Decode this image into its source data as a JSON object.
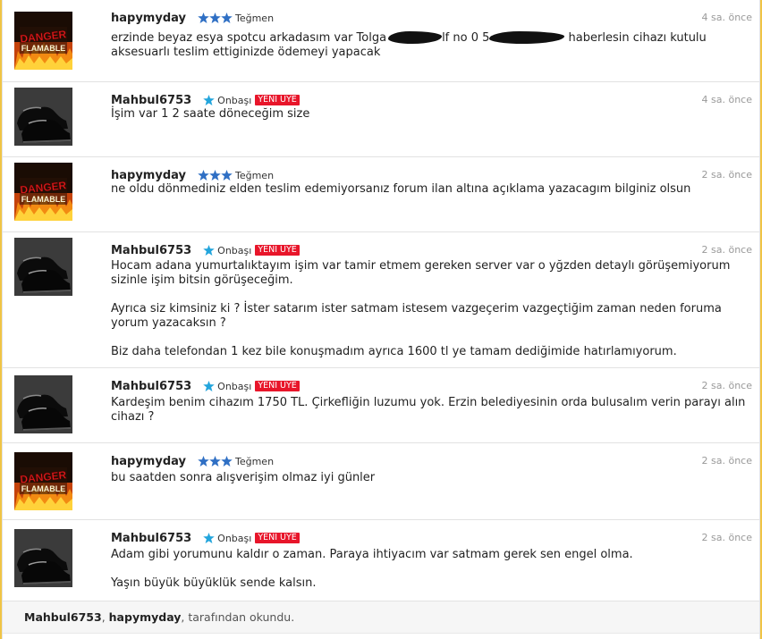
{
  "messages": [
    {
      "user": "hapymyday",
      "rank": "Teğmen",
      "stars": 3,
      "avatar": "danger-flamable",
      "time": "4 sa. önce",
      "paragraphs": []
    },
    {
      "user": "Mahbul6753",
      "rank": "Onbaşı",
      "stars": 1,
      "badge": "YENİ ÜYE",
      "avatar": "shoes",
      "time": "4 sa. önce",
      "paragraphs": [
        "İşim var 1 2 saate döneceğim size"
      ]
    },
    {
      "user": "hapymyday",
      "rank": "Teğmen",
      "stars": 3,
      "avatar": "danger-flamable",
      "time": "2 sa. önce",
      "paragraphs": [
        "ne oldu dönmediniz elden teslim edemiyorsanız forum ilan altına açıklama yazacagım bilginiz olsun"
      ]
    },
    {
      "user": "Mahbul6753",
      "rank": "Onbaşı",
      "stars": 1,
      "badge": "YENİ ÜYE",
      "avatar": "shoes",
      "time": "2 sa. önce",
      "paragraphs": [
        "Hocam adana yumurtalıktayım işim var tamir etmem gereken server var o yğzden detaylı görüşemiyorum sizinle işim bitsin görüşeceğim.",
        "Ayrıca siz kimsiniz ki ? İster satarım ister satmam istesem vazgeçerim vazgeçtiğim zaman neden foruma yorum yazacaksın ?",
        "Biz daha telefondan 1 kez bile konuşmadım ayrıca 1600 tl ye tamam dediğimide hatırlamıyorum."
      ]
    },
    {
      "user": "Mahbul6753",
      "rank": "Onbaşı",
      "stars": 1,
      "badge": "YENİ ÜYE",
      "avatar": "shoes",
      "time": "2 sa. önce",
      "paragraphs": [
        "Kardeşim benim cihazım 1750 TL. Çirkefliğin luzumu yok. Erzin belediyesinin orda bulusalım verin parayı alın cihazı ?"
      ]
    },
    {
      "user": "hapymyday",
      "rank": "Teğmen",
      "stars": 3,
      "avatar": "danger-flamable",
      "time": "2 sa. önce",
      "paragraphs": [
        "bu saatden sonra alışverişim olmaz iyi günler"
      ]
    },
    {
      "user": "Mahbul6753",
      "rank": "Onbaşı",
      "stars": 1,
      "badge": "YENİ ÜYE",
      "avatar": "shoes",
      "time": "2 sa. önce",
      "paragraphs": [
        "Adam gibi yorumunu kaldır o zaman. Paraya ihtiyacım var satmam gerek sen engel olma.",
        "Yaşın büyük büyüklük sende kalsın."
      ]
    }
  ],
  "first_message_fragments": {
    "a": "erzinde beyaz esya spotcu arkadasım var Tolga",
    "b": "lf no 0 5",
    "c": "haberlesin cihazı kutulu",
    "d": "aksesuarlı teslim ettiginizde ödemeyi yapacak"
  },
  "avatar_text": {
    "line1": "DANGER",
    "line2": "FLAMABLE"
  },
  "footer": {
    "reader1": "Mahbul6753",
    "sep": ", ",
    "reader2": "hapymyday",
    "suffix": ", tarafından okundu."
  },
  "colors": {
    "star_blue": "#2f6fc4",
    "star_cyan": "#23a5dc",
    "badge_red": "#e8152a",
    "frame_yellow": "#f0c445"
  }
}
